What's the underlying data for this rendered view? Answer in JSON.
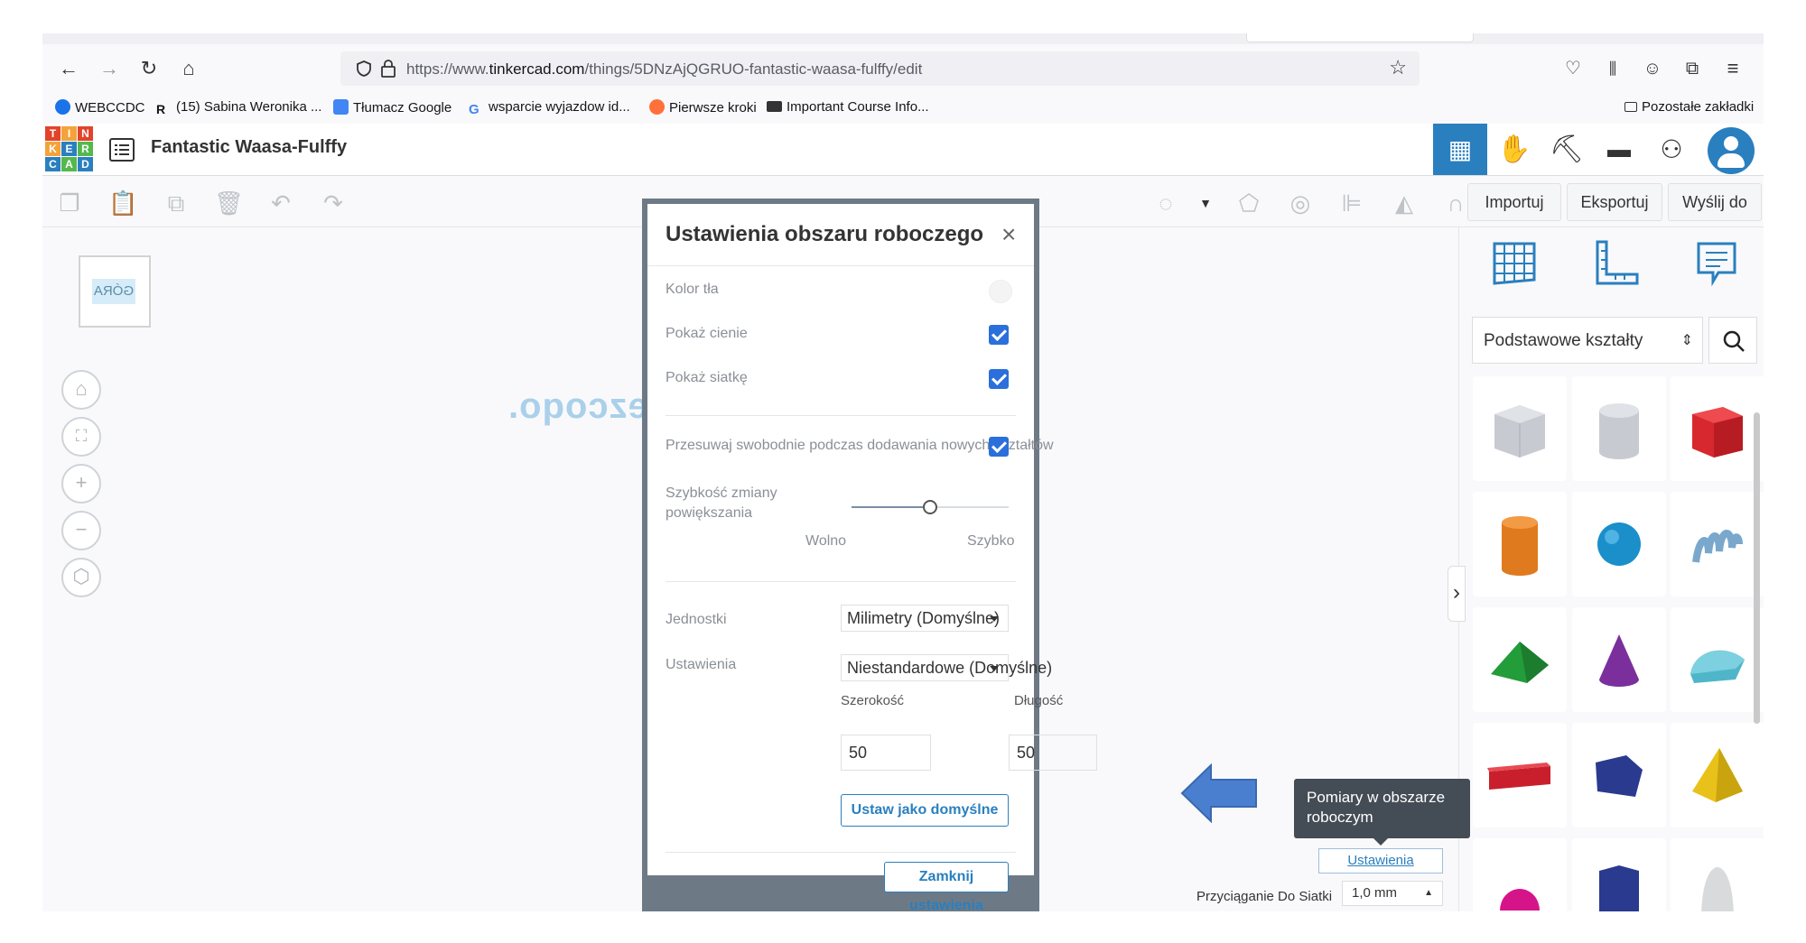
{
  "browser": {
    "url_prefix": "https://www.",
    "url_domain": "tinkercad.com",
    "url_path": "/things/5DNzAjQGRUO-fantastic-waasa-fulffy/edit",
    "bookmarks": [
      {
        "label": "WEBCCDC",
        "color": "#1a73e8"
      },
      {
        "label": "(15) Sabina Weronika ...",
        "color": "#333333"
      },
      {
        "label": "Tłumacz Google",
        "color": "#4285f4"
      },
      {
        "label": "wsparcie wyjazdow id...",
        "color": "#4285f4"
      },
      {
        "label": "Pierwsze kroki",
        "color": "#ff7139"
      },
      {
        "label": "Important Course Info...",
        "color": "#333333"
      }
    ],
    "other_bookmarks": "Pozostałe zakładki"
  },
  "header": {
    "logo_letters": [
      "T",
      "I",
      "N",
      "K",
      "E",
      "R",
      "C",
      "A",
      "D"
    ],
    "title": "Fantastic Waasa-Fulffy"
  },
  "toolbar": {
    "import_label": "Importuj",
    "export_label": "Eksportuj",
    "send_label": "Wyślij do"
  },
  "workspace": {
    "viewcube_label": "GÓRA",
    "grid_text": "ezcoqo."
  },
  "panel": {
    "category": "Podstawowe kształty"
  },
  "modal": {
    "title": "Ustawienia obszaru roboczego",
    "close": "×",
    "bg_color_label": "Kolor tła",
    "shadows_label": "Pokaż cienie",
    "grid_label": "Pokaż siatkę",
    "free_move_label": "Przesuwaj swobodnie podczas dodawania nowych kształtów",
    "zoom_speed_label_1": "Szybkość zmiany",
    "zoom_speed_label_2": "powiększania",
    "zoom_speed": 0.5,
    "slow_label": "Wolno",
    "fast_label": "Szybko",
    "units_label": "Jednostki",
    "units_value": "Milimetry (Domyślne)",
    "settings_label": "Ustawienia",
    "settings_value": "Niestandardowe (Domyślne)",
    "width_label": "Szerokość",
    "length_label": "Długość",
    "width_value": "50",
    "length_value": "50",
    "set_default_label": "Ustaw jako domyślne",
    "close_settings_label": "Zamknij ustawienia",
    "checkbox_color": "#2a6fdb"
  },
  "tooltip": {
    "line1": "Pomiary w obszarze",
    "line2": "roboczym"
  },
  "bottom": {
    "settings_link": "Ustawienia",
    "snap_label": "Przyciąganie Do Siatki",
    "snap_value": "1,0 mm"
  }
}
